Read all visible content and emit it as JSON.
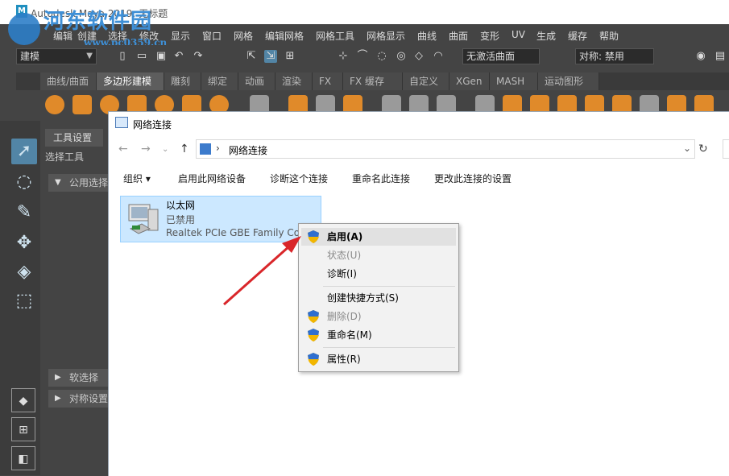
{
  "maya": {
    "title": "Autodesk Maya 2019: 无标题",
    "menu": [
      "编辑",
      "创建",
      "选择",
      "修改",
      "显示",
      "窗口",
      "网格",
      "编辑网格",
      "网格工具",
      "网格显示",
      "曲线",
      "曲面",
      "变形",
      "UV",
      "生成",
      "缓存",
      "帮助"
    ],
    "mode": "建模",
    "selection_field": "无激活曲面",
    "symmetry_field": "对称: 禁用",
    "shelf_tabs": [
      "曲线/曲面",
      "多边形建模",
      "雕刻",
      "绑定",
      "动画",
      "渲染",
      "FX",
      "FX 缓存",
      "自定义",
      "XGen",
      "MASH",
      "运动图形"
    ],
    "active_shelf_tab": "多边形建模",
    "tool_settings": {
      "tab": "工具设置",
      "subtitle": "选择工具",
      "sections": [
        "公用选择设置",
        "软选择",
        "对称设置"
      ]
    }
  },
  "watermark": {
    "name": "河东软件园",
    "url": "www.pc0359.cn"
  },
  "network_window": {
    "title": "网络连接",
    "path": "网络连接",
    "commands": [
      "组织 ▾",
      "启用此网络设备",
      "诊断这个连接",
      "重命名此连接",
      "更改此连接的设置"
    ],
    "adapter": {
      "name": "以太网",
      "status": "已禁用",
      "device": "Realtek PCIe GBE Family Controller"
    }
  },
  "context_menu": {
    "items": [
      {
        "label": "启用(A)",
        "shield": true,
        "state": "highlighted"
      },
      {
        "label": "状态(U)",
        "shield": false,
        "state": "disabled"
      },
      {
        "label": "诊断(I)",
        "shield": false,
        "state": "normal"
      },
      {
        "label": "创建快捷方式(S)",
        "shield": false,
        "state": "normal"
      },
      {
        "label": "删除(D)",
        "shield": true,
        "state": "disabled"
      },
      {
        "label": "重命名(M)",
        "shield": true,
        "state": "normal"
      },
      {
        "label": "属性(R)",
        "shield": true,
        "state": "normal"
      }
    ]
  },
  "colors": {
    "maya_bg": "#444444",
    "accent_blue": "#5285a6",
    "selection_bg": "#cce8ff",
    "arrow_red": "#d9262a"
  }
}
